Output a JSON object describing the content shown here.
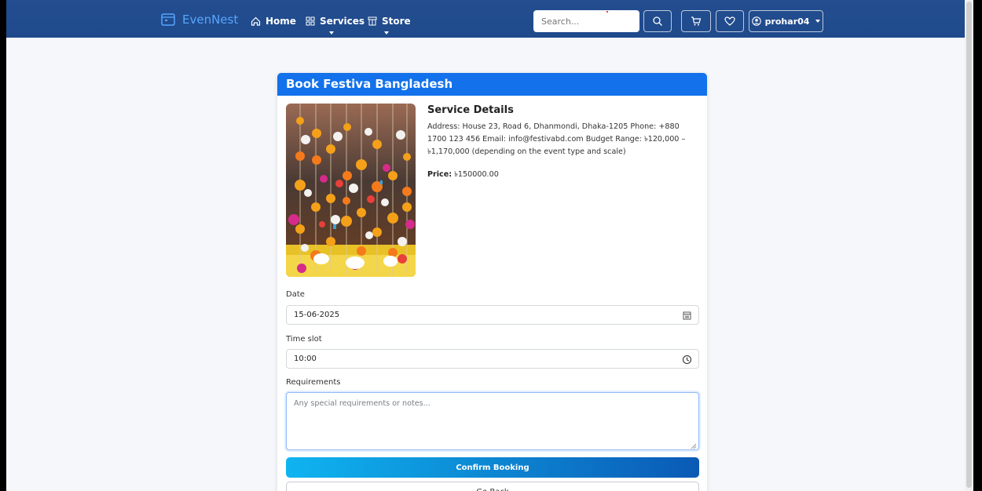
{
  "navbar": {
    "brand": "EvenNest",
    "items": [
      {
        "label": "Home",
        "icon": "home-icon"
      },
      {
        "label": "Services",
        "icon": "grid-icon"
      },
      {
        "label": "Store",
        "icon": "store-icon"
      }
    ],
    "search": {
      "placeholder": "Search..."
    },
    "user": {
      "label": "prohar04"
    }
  },
  "card": {
    "title": "Book Festiva Bangladesh",
    "details": {
      "heading": "Service Details",
      "text": "Address: House 23, Road 6, Dhanmondi, Dhaka-1205 Phone: +880 1700 123 456 Email: info@festivabd.com Budget Range: ৳120,000 – ৳1,170,000 (depending on the event type and scale)",
      "price_label": "Price:",
      "price_value": "৳150000.00"
    },
    "form": {
      "date_label": "Date",
      "date_value": "15-06-2025",
      "time_label": "Time slot",
      "time_value": "10:00",
      "requirements_label": "Requirements",
      "requirements_placeholder": "Any special requirements or notes...",
      "confirm_label": "Confirm Booking",
      "back_label": "Go Back"
    }
  },
  "colors": {
    "navbar": "#1f4a8c",
    "brand": "#58a6ff",
    "card_header": "#1271eb",
    "button_start": "#0fb4f0",
    "button_end": "#0a5ab5"
  }
}
